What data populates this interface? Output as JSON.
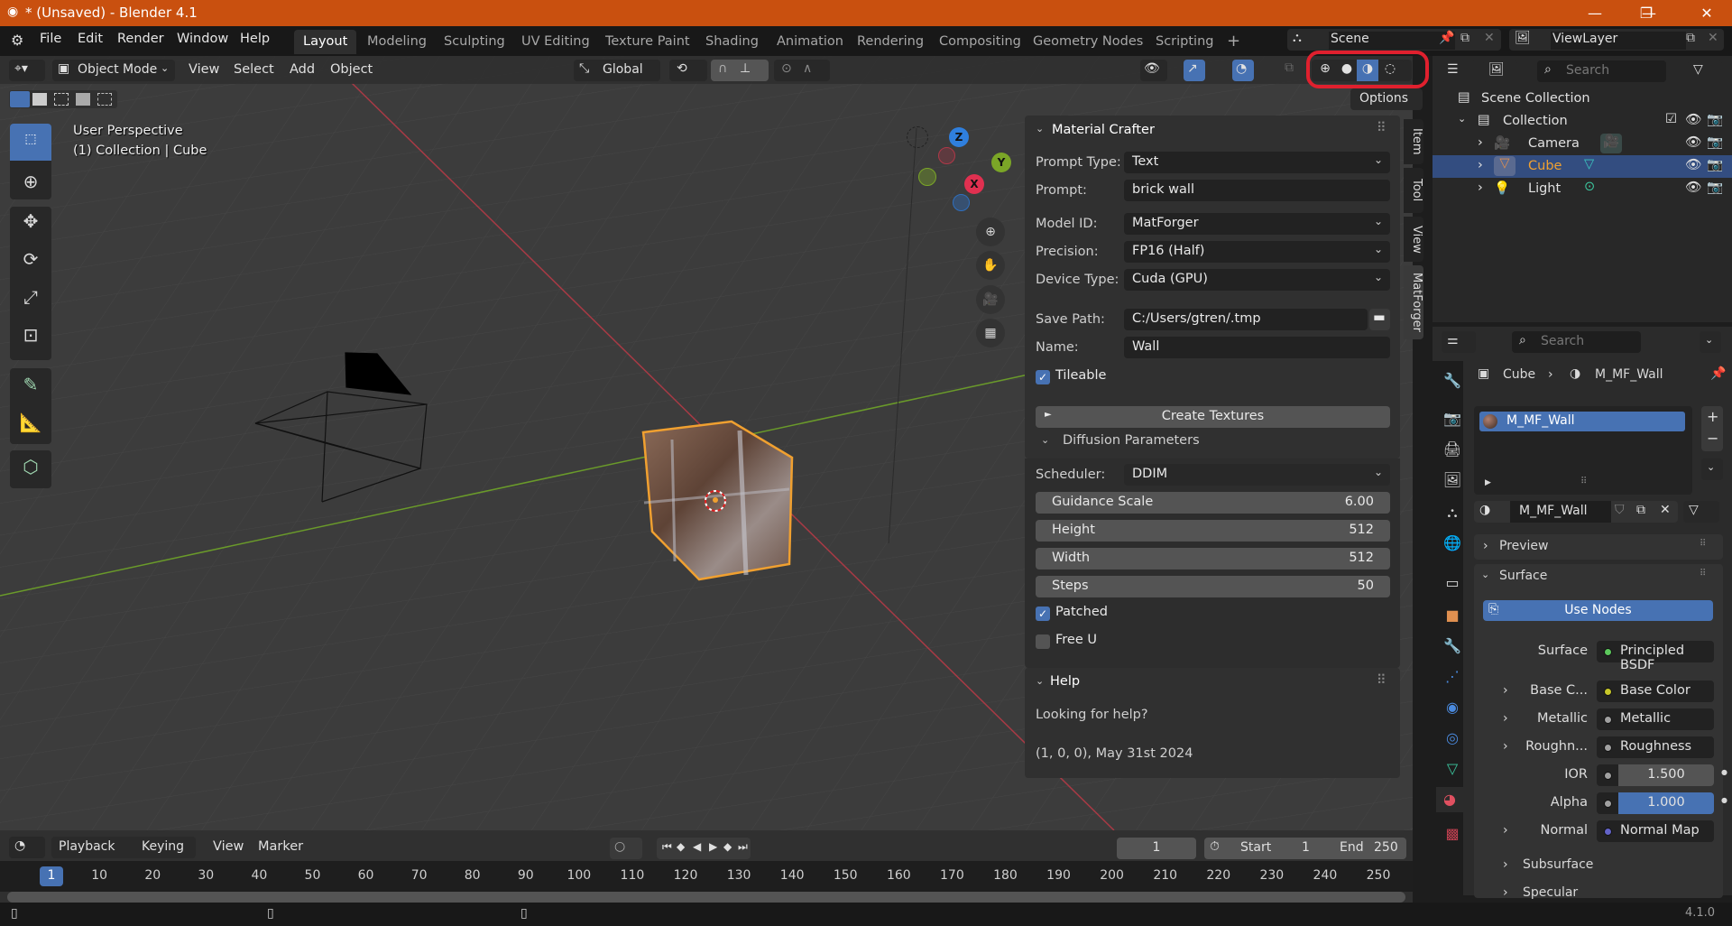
{
  "window": {
    "title": "* (Unsaved) - Blender 4.1",
    "controls": [
      "minimize",
      "restore",
      "close"
    ]
  },
  "menubar": [
    "File",
    "Edit",
    "Render",
    "Window",
    "Help"
  ],
  "workspaces": [
    {
      "label": "Layout",
      "active": true
    },
    {
      "label": "Modeling"
    },
    {
      "label": "Sculpting"
    },
    {
      "label": "UV Editing"
    },
    {
      "label": "Texture Paint"
    },
    {
      "label": "Shading"
    },
    {
      "label": "Animation"
    },
    {
      "label": "Rendering"
    },
    {
      "label": "Compositing"
    },
    {
      "label": "Geometry Nodes"
    },
    {
      "label": "Scripting"
    }
  ],
  "add_workspace": "+",
  "scene": {
    "name": "Scene",
    "view_layer": "ViewLayer"
  },
  "viewport_header": {
    "mode": "Object Mode",
    "menus": [
      "View",
      "Select",
      "Add",
      "Object"
    ],
    "orientation": "Global",
    "options": "Options"
  },
  "shading_modes": [
    "wireframe",
    "solid",
    "material-preview",
    "rendered"
  ],
  "shading_active": "material-preview",
  "overlay": {
    "line1": "User Perspective",
    "line2": "(1) Collection | Cube"
  },
  "gizmo": {
    "x": "X",
    "y": "Y",
    "z": "Z"
  },
  "npanel": {
    "title": "Material Crafter",
    "fields": {
      "prompt_type_label": "Prompt Type:",
      "prompt_type": "Text",
      "prompt_label": "Prompt:",
      "prompt": "brick wall",
      "model_label": "Model ID:",
      "model": "MatForger",
      "precision_label": "Precision:",
      "precision": "FP16 (Half)",
      "device_label": "Device Type:",
      "device": "Cuda (GPU)",
      "save_label": "Save Path:",
      "save_path": "C:/Users/gtren/.tmp",
      "name_label": "Name:",
      "name": "Wall",
      "tileable": "Tileable"
    },
    "create_button": "Create Textures",
    "diffusion": {
      "title": "Diffusion Parameters",
      "scheduler_label": "Scheduler:",
      "scheduler": "DDIM",
      "sliders": [
        {
          "label": "Guidance Scale",
          "value": "6.00"
        },
        {
          "label": "Height",
          "value": "512"
        },
        {
          "label": "Width",
          "value": "512"
        },
        {
          "label": "Steps",
          "value": "50"
        }
      ],
      "patched": "Patched",
      "freeu": "Free U"
    },
    "help": {
      "title": "Help",
      "text": "Looking for help?",
      "info": "(1, 0, 0), May 31st 2024"
    },
    "tabs": [
      "Item",
      "Tool",
      "View",
      "MatForger"
    ]
  },
  "outliner": {
    "search_placeholder": "Search",
    "root": "Scene Collection",
    "collection": "Collection",
    "items": [
      {
        "label": "Camera",
        "selected": false
      },
      {
        "label": "Cube",
        "selected": true
      },
      {
        "label": "Light",
        "selected": false
      }
    ]
  },
  "properties": {
    "search_placeholder": "Search",
    "breadcrumb_object": "Cube",
    "breadcrumb_material": "M_MF_Wall",
    "slot": "M_MF_Wall",
    "material_name": "M_MF_Wall",
    "panels": {
      "preview": "Preview",
      "surface": "Surface"
    },
    "use_nodes": "Use Nodes",
    "rows": [
      {
        "label": "Surface",
        "value": "Principled BSDF",
        "dot": "#5cc85c",
        "expand": false
      },
      {
        "label": "Base C...",
        "value": "Base Color",
        "dot": "#c7c729",
        "expand": true
      },
      {
        "label": "Metallic",
        "value": "Metallic",
        "dot": "#a0a0a0",
        "expand": true
      },
      {
        "label": "Roughn...",
        "value": "Roughness",
        "dot": "#a0a0a0",
        "expand": true
      },
      {
        "label": "IOR",
        "value": "1.500",
        "dot": "#a0a0a0",
        "expand": false
      },
      {
        "label": "Alpha",
        "value": "1.000",
        "dot": "#a0a0a0",
        "expand": false
      },
      {
        "label": "Normal",
        "value": "Normal Map",
        "dot": "#6363c7",
        "expand": true
      }
    ],
    "sections": [
      "Subsurface",
      "Specular"
    ]
  },
  "timeline": {
    "menus": [
      "Playback",
      "Keying",
      "View",
      "Marker"
    ],
    "current_frame": "1",
    "start_label": "Start",
    "start": "1",
    "end_label": "End",
    "end": "250",
    "ticks": [
      "10",
      "20",
      "30",
      "40",
      "50",
      "60",
      "70",
      "80",
      "90",
      "100",
      "110",
      "120",
      "130",
      "140",
      "150",
      "160",
      "170",
      "180",
      "190",
      "200",
      "210",
      "220",
      "230",
      "240",
      "250"
    ]
  },
  "status": {
    "version": "4.1.0"
  }
}
